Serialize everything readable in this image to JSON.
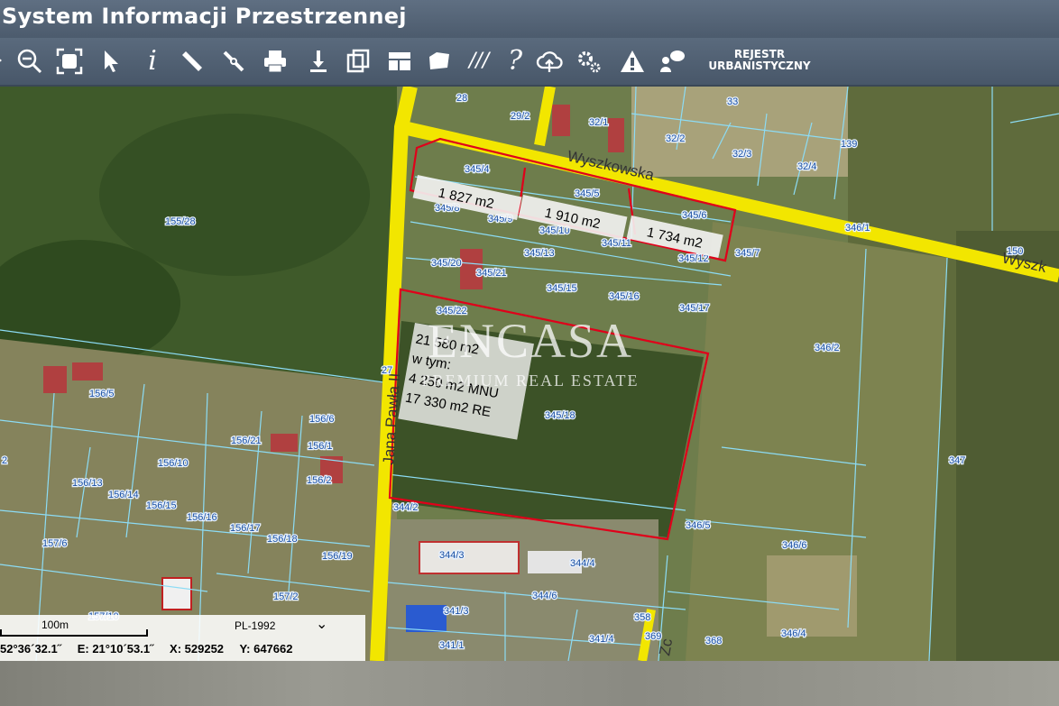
{
  "app": {
    "title": "System Informacji Przestrzennej"
  },
  "toolbar": {
    "rejestr_line1": "REJESTR",
    "rejestr_line2": "URBANISTYCZNY",
    "tools": [
      {
        "name": "zoom-out-icon",
        "glyph": "🔍"
      },
      {
        "name": "zoom-extent-icon",
        "glyph": "⛶"
      },
      {
        "name": "select-arrow-icon",
        "glyph": "➤"
      },
      {
        "name": "info-icon",
        "glyph": "i"
      },
      {
        "name": "measure-ruler-icon",
        "glyph": "📏"
      },
      {
        "name": "measure-line-icon",
        "glyph": "✎"
      },
      {
        "name": "print-icon",
        "glyph": "🖶"
      },
      {
        "name": "download-icon",
        "glyph": "⇩"
      },
      {
        "name": "layers-icon",
        "glyph": "❐"
      },
      {
        "name": "layout-icon",
        "glyph": "▦"
      },
      {
        "name": "shape-icon",
        "glyph": "◗"
      },
      {
        "name": "hatch-icon",
        "glyph": "///"
      },
      {
        "name": "help-icon",
        "glyph": "?"
      },
      {
        "name": "cloud-upload-icon",
        "glyph": "☁"
      },
      {
        "name": "settings-icon",
        "glyph": "⚙"
      },
      {
        "name": "warning-icon",
        "glyph": "⚠"
      },
      {
        "name": "comment-user-icon",
        "glyph": "💬"
      }
    ]
  },
  "map": {
    "streets": [
      "Wyszkowska",
      "Jana Pawła II",
      "Wyszk",
      "Zc"
    ],
    "parcels": [
      "28",
      "29/2",
      "32/1",
      "33",
      "32/2",
      "32/3",
      "32/4",
      "139",
      "345/4",
      "345/5",
      "345/6",
      "345/8",
      "345/9",
      "345/10",
      "345/11",
      "345/12",
      "345/13",
      "345/7",
      "345/20",
      "345/21",
      "345/15",
      "345/16",
      "345/17",
      "345/22",
      "345/18",
      "346/1",
      "346/2",
      "347",
      "155/28",
      "156/5",
      "156/6",
      "156/21",
      "156/1",
      "156/10",
      "156/13",
      "156/14",
      "156/15",
      "156/16",
      "156/2",
      "156/17",
      "156/18",
      "156/19",
      "157/6",
      "157/2",
      "157/10",
      "27",
      "2",
      "344/2",
      "344/3",
      "344/4",
      "344/6",
      "341/3",
      "341/4",
      "341/1",
      "358",
      "369",
      "368",
      "346/4",
      "346/5",
      "346/6",
      "150"
    ],
    "area_labels": [
      "1 827 m2",
      "1 910 m2",
      "1 734 m2"
    ],
    "big_plot_text": [
      "21 580 m2",
      "w tym:",
      "4 250 m2 MNU",
      "17 330 m2 RE"
    ],
    "watermark_line1": "ENCASA",
    "watermark_line2": "PREMIUM REAL ESTATE",
    "colors": {
      "road": "#f2e600",
      "plot_outline": "#e0001a",
      "parcel_line": "#7fd4f0"
    }
  },
  "scale": {
    "distance": "100m",
    "crs": "PL-1992",
    "lat": "52°36´32.1˝",
    "lon": "E: 21°10´53.1˝",
    "x": "X: 529252",
    "y": "Y: 647662"
  }
}
